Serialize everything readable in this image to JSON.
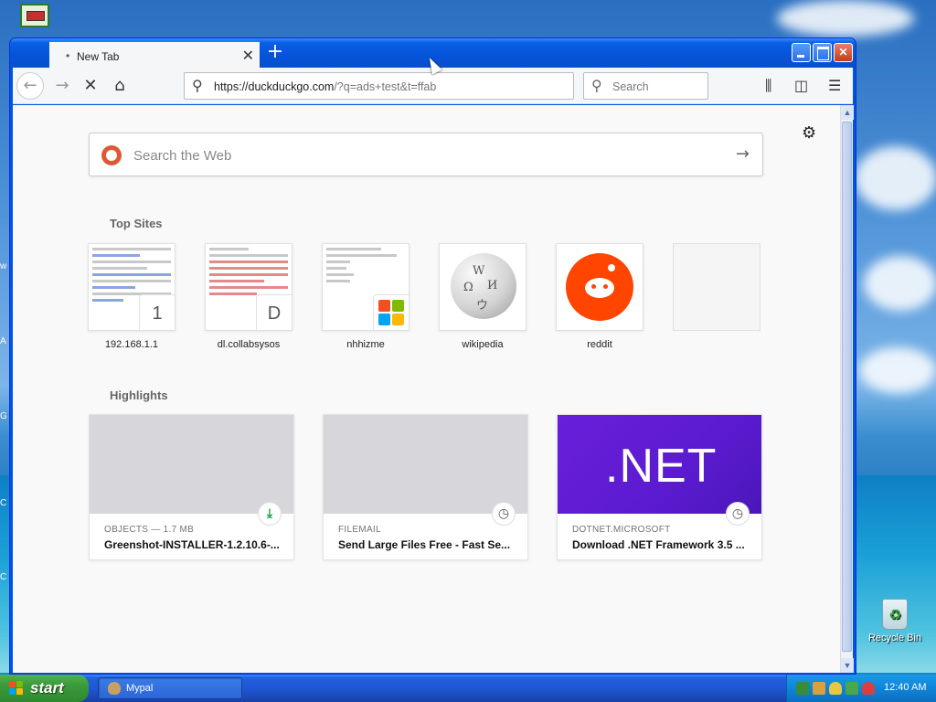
{
  "browser": {
    "tab_title": "New Tab",
    "url": {
      "host": "https://duckduckgo.com",
      "rest": "/?q=ads+test&t=ffab"
    },
    "search_placeholder": "Search"
  },
  "newtab": {
    "websearch_placeholder": "Search the Web",
    "top_sites_title": "Top Sites",
    "top_sites": [
      {
        "label": "192.168.1.1",
        "badge": "1"
      },
      {
        "label": "dl.collabsysos",
        "badge": "D"
      },
      {
        "label": "nhhizme",
        "badge": ""
      },
      {
        "label": "wikipedia",
        "badge": ""
      },
      {
        "label": "reddit",
        "badge": ""
      }
    ],
    "highlights_title": "Highlights",
    "highlights": [
      {
        "source": "OBJECTS — 1.7 MB",
        "title": "Greenshot-INSTALLER-1.2.10.6-..."
      },
      {
        "source": "FILEMAIL",
        "title": "Send Large Files Free - Fast Se..."
      },
      {
        "source": "DOTNET.MICROSOFT",
        "title": "Download .NET Framework 3.5 ...",
        "image_text": ".NET"
      }
    ]
  },
  "desktop": {
    "recycle_bin_label": "Recycle Bin"
  },
  "taskbar": {
    "start_label": "start",
    "task_label": "Mypal",
    "clock": "12:40 AM"
  },
  "colors": {
    "accent": "#0a84ff",
    "xp_blue": "#0054e3",
    "reddit": "#ff4500",
    "net_purple": "#5b1bd0"
  }
}
